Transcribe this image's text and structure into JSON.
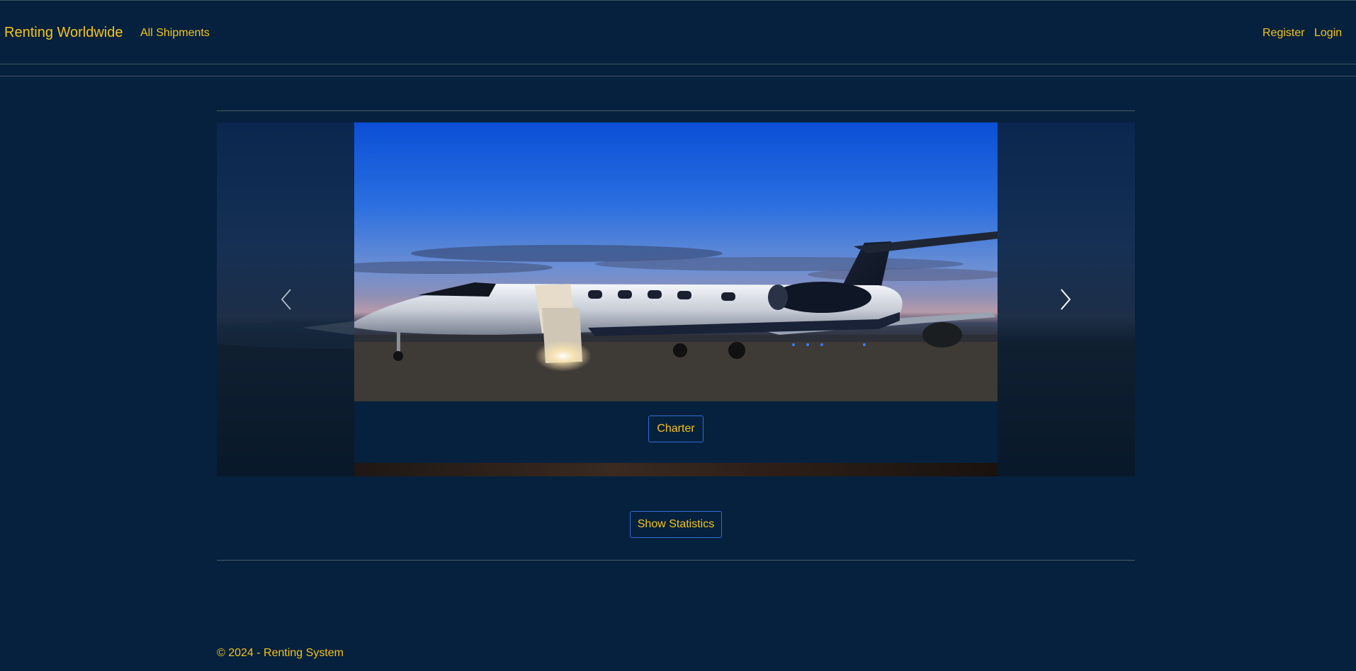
{
  "navbar": {
    "brand": "Renting Worldwide",
    "links": [
      {
        "label": "All Shipments"
      }
    ],
    "right_links": [
      {
        "label": "Register"
      },
      {
        "label": "Login"
      }
    ]
  },
  "carousel": {
    "slides": [
      {
        "image_subject": "private jet on tarmac at dusk",
        "button_label": "Charter"
      }
    ],
    "prev_icon": "chevron-left-icon",
    "next_icon": "chevron-right-icon"
  },
  "main": {
    "stats_button_label": "Show Statistics"
  },
  "footer": {
    "text": "© 2024 - Renting System"
  },
  "colors": {
    "background": "#06213d",
    "accent_text": "#f4c41d",
    "button_border": "#2f6bd8",
    "divider": "#4a5e6c"
  }
}
